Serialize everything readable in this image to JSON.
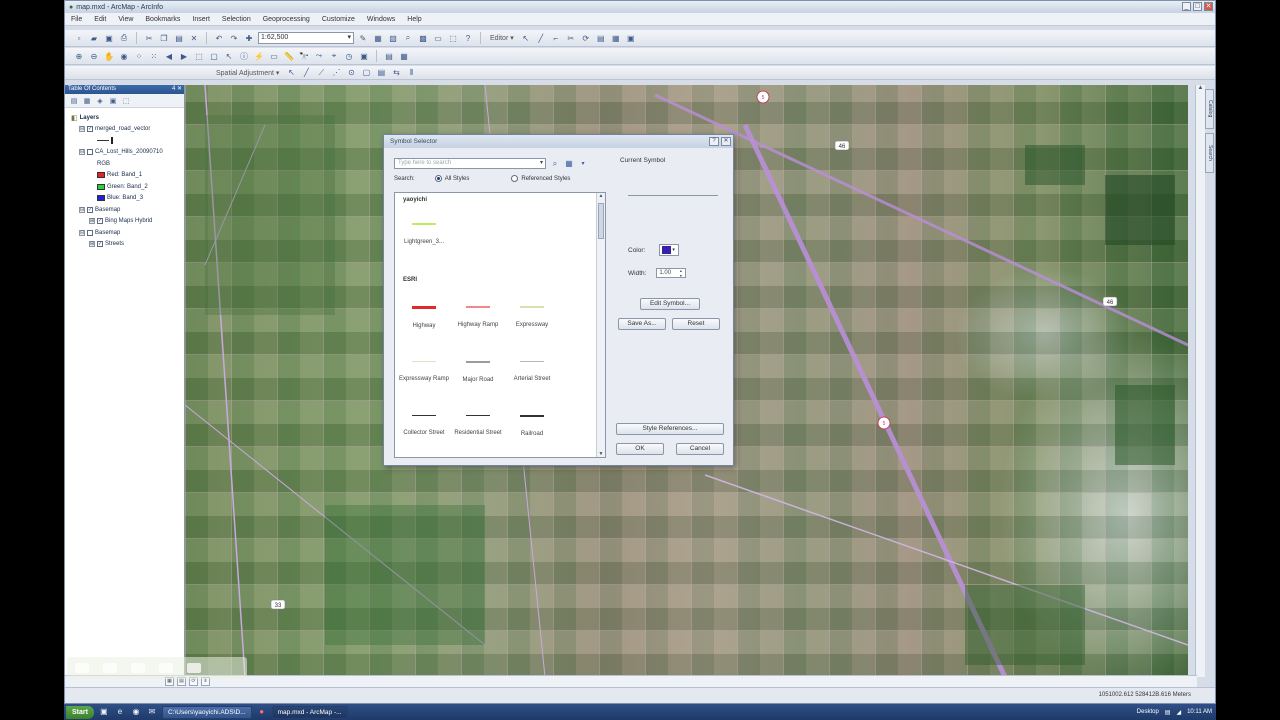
{
  "window": {
    "title": "map.mxd - ArcMap - ArcInfo",
    "min": "_",
    "max": "□",
    "close": "✕"
  },
  "menu": [
    "File",
    "Edit",
    "View",
    "Bookmarks",
    "Insert",
    "Selection",
    "Geoprocessing",
    "Customize",
    "Windows",
    "Help"
  ],
  "toolbar": {
    "scale": "1:62,500",
    "editor": "Editor ▾",
    "spatial_adjustment": "Spatial Adjustment ▾"
  },
  "toc": {
    "title": "Table Of Contents",
    "pin": "4 ✕",
    "root": "Layers",
    "layers": [
      {
        "name": "merged_road_vector",
        "checked": true,
        "level": 1,
        "expander": "⊟"
      },
      {
        "name": "CA_Lost_Hills_20090710",
        "checked": false,
        "level": 1,
        "expander": "⊟"
      },
      {
        "name": "RGB",
        "level": 2
      },
      {
        "name": "Red:   Band_1",
        "level": 3,
        "swatch": "#e8202a"
      },
      {
        "name": "Green: Band_2",
        "level": 3,
        "swatch": "#27d13a"
      },
      {
        "name": "Blue:  Band_3",
        "level": 3,
        "swatch": "#2020d6"
      },
      {
        "name": "Basemap",
        "checked": true,
        "level": 1,
        "expander": "⊟"
      },
      {
        "name": "Bing Maps Hybrid",
        "checked": true,
        "level": 2,
        "expander": "⊞"
      },
      {
        "name": "Basemap",
        "checked": false,
        "level": 1,
        "expander": "⊟"
      },
      {
        "name": "Streets",
        "checked": true,
        "level": 2,
        "expander": "⊞"
      }
    ]
  },
  "dialog": {
    "title": "Symbol Selector",
    "search_placeholder": "Type here to search",
    "search_label": "Search:",
    "all_styles": "All Styles",
    "referenced_styles": "Referenced Styles",
    "current_symbol": "Current Symbol",
    "color_label": "Color:",
    "color_value": "#3a1fa8",
    "width_label": "Width:",
    "width_value": "1.00",
    "edit_symbol": "Edit Symbol...",
    "save_as": "Save As...",
    "reset": "Reset",
    "style_references": "Style References...",
    "ok": "OK",
    "cancel": "Cancel",
    "groups": [
      {
        "name": "yaoyichi",
        "symbols": [
          {
            "label": "Lightgreen_3...",
            "color": "#b8ef60",
            "width": 2
          }
        ]
      },
      {
        "name": "ESRI",
        "symbols": [
          {
            "label": "Highway",
            "color": "#e32a2a",
            "width": 3
          },
          {
            "label": "Highway Ramp",
            "color": "#f08a8a",
            "width": 2
          },
          {
            "label": "Expressway",
            "color": "#d4e2b0",
            "width": 2
          },
          {
            "label": "Expressway Ramp",
            "color": "#d6e6c2",
            "width": 1
          },
          {
            "label": "Major Road",
            "color": "#9c9c9c",
            "width": 2
          },
          {
            "label": "Arterial Street",
            "color": "#b7b7b7",
            "width": 1
          },
          {
            "label": "Collector Street",
            "color": "#333333",
            "width": 1
          },
          {
            "label": "Residential Street",
            "color": "#333333",
            "width": 1
          },
          {
            "label": "Railroad",
            "color": "#333333",
            "width": 2
          }
        ]
      }
    ]
  },
  "statusbar": {
    "coords": "1051002.612  528412B.616 Meters"
  },
  "taskbar": {
    "start": "Start",
    "tasks": [
      "C:\\Users\\yaoyichi.ADS\\D...",
      "map.mxd - ArcMap -..."
    ],
    "desktop": "Desktop",
    "time": "10:11 AM"
  },
  "map": {
    "road_color": "#b98fd8",
    "shield_1": "46",
    "shield_2": "46",
    "shield_3": "33",
    "shield_4": "5"
  }
}
